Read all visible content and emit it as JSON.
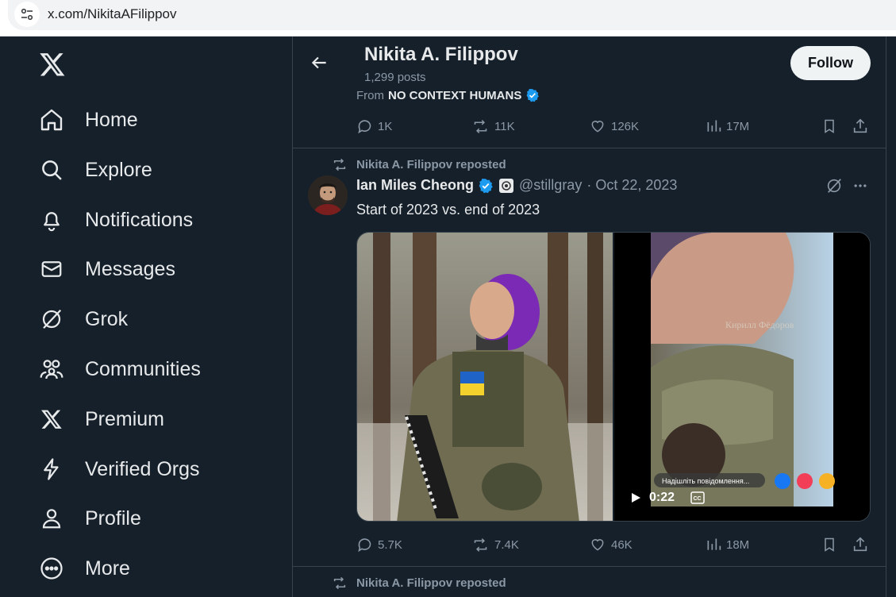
{
  "browser": {
    "url": "x.com/NikitaAFilippov"
  },
  "sidebar": {
    "items": [
      {
        "label": "Home",
        "icon": "home-icon"
      },
      {
        "label": "Explore",
        "icon": "search-icon"
      },
      {
        "label": "Notifications",
        "icon": "bell-icon"
      },
      {
        "label": "Messages",
        "icon": "envelope-icon"
      },
      {
        "label": "Grok",
        "icon": "grok-icon"
      },
      {
        "label": "Communities",
        "icon": "communities-icon"
      },
      {
        "label": "Premium",
        "icon": "x-logo-icon"
      },
      {
        "label": "Verified Orgs",
        "icon": "lightning-icon"
      },
      {
        "label": "Profile",
        "icon": "person-icon"
      },
      {
        "label": "More",
        "icon": "more-circle-icon"
      }
    ]
  },
  "header": {
    "name": "Nikita A. Filippov",
    "posts": "1,299 posts",
    "follow_label": "Follow"
  },
  "prev_tweet": {
    "from_prefix": "From",
    "from_account": "NO CONTEXT HUMANS",
    "replies": "1K",
    "reposts": "11K",
    "likes": "126K",
    "views": "17M"
  },
  "tweet": {
    "repost_label": "Nikita A. Filippov reposted",
    "author": "Ian Miles Cheong",
    "handle": "@stillgray",
    "date": "· Oct 22, 2023",
    "text": "Start of 2023 vs. end of 2023",
    "video_duration": "0:22",
    "watermark": "Кирилл Фёдоров",
    "video_overlay": "Надішліть повідомлення...",
    "replies": "5.7K",
    "reposts": "7.4K",
    "likes": "46K",
    "views": "18M"
  },
  "next_tweet": {
    "repost_label": "Nikita A. Filippov reposted"
  },
  "colors": {
    "bg": "#15202b",
    "border": "#38444d",
    "muted": "#8b98a5",
    "verified": "#1d9bf0",
    "text": "#e7e9ea"
  }
}
